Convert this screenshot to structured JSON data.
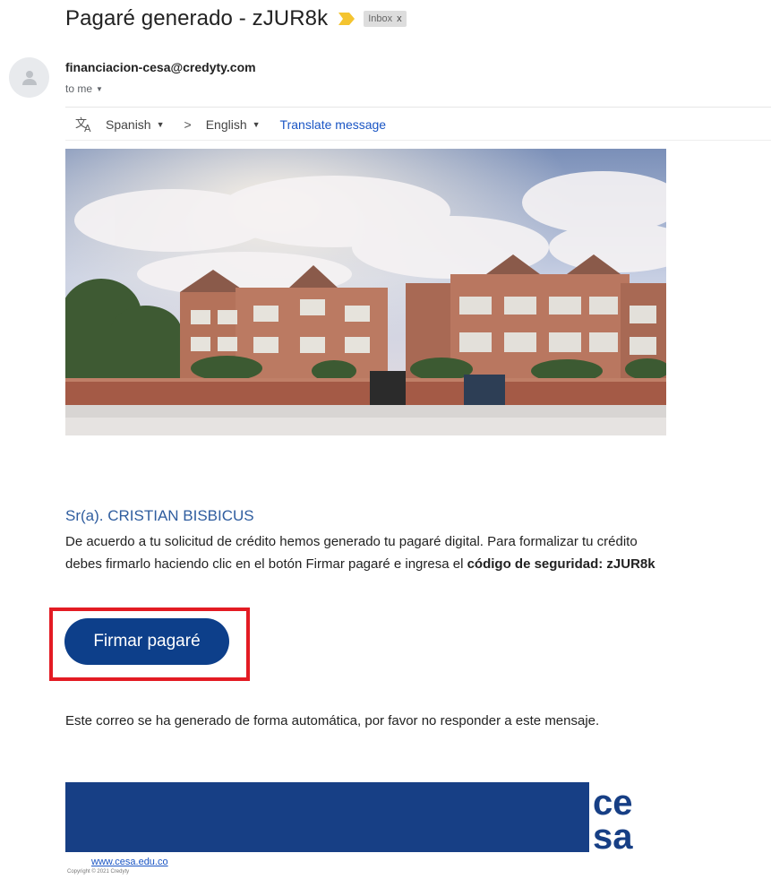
{
  "email": {
    "subject": "Pagaré generado - zJUR8k",
    "label": "Inbox",
    "label_close": "x",
    "sender": "financiacion-cesa@credyty.com",
    "recipient": "to me"
  },
  "translate": {
    "from_lang": "Spanish",
    "to_lang": "English",
    "arrow": ">",
    "action": "Translate message"
  },
  "body": {
    "greeting": "Sr(a). CRISTIAN BISBICUS",
    "paragraph_start": "De acuerdo a tu solicitud de crédito hemos generado tu pagaré digital. Para formalizar tu crédito debes firmarlo haciendo clic en el botón Firmar pagaré e ingresa el ",
    "paragraph_bold": "código de seguridad: zJUR8k",
    "button": "Firmar pagaré",
    "auto_note": "Este correo se ha generado de forma automática, por favor no responder a este mensaje."
  },
  "footer": {
    "logo_text_top": "ce",
    "logo_text_bottom": "sa",
    "link": "www.cesa.edu.co",
    "copyright": "Copyright © 2021 Credyty"
  },
  "colors": {
    "accent_blue": "#0d3f8a",
    "footer_blue": "#173f85",
    "highlight_red": "#e31b23",
    "link_blue": "#1a55c4",
    "important_marker": "#f4c430"
  },
  "icons": {
    "important": "important-marker-icon",
    "avatar": "person-icon",
    "translate": "translate-icon",
    "recipient_caret": "caret-down-icon"
  }
}
